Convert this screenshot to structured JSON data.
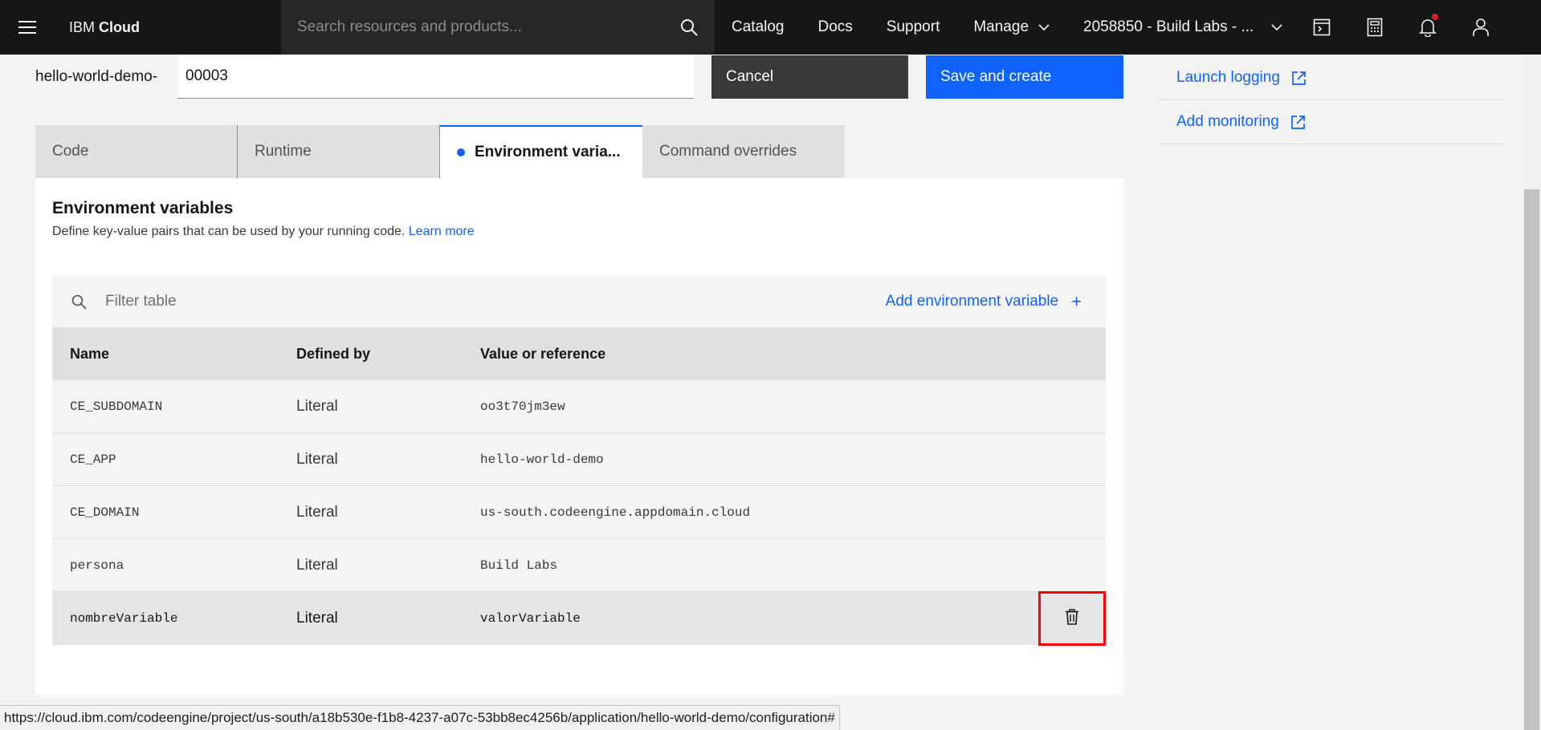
{
  "header": {
    "brand_light": "IBM ",
    "brand_bold": "Cloud",
    "search_placeholder": "Search resources and products...",
    "nav": [
      "Catalog",
      "Docs",
      "Support"
    ],
    "manage_label": "Manage",
    "account_label": "2058850 - Build Labs - ..."
  },
  "form": {
    "name_prefix": "hello-world-demo-",
    "name_value": "00003",
    "cancel_label": "Cancel",
    "save_label": "Save and create"
  },
  "side_links": {
    "logging": "Launch logging",
    "monitoring": "Add monitoring"
  },
  "tabs": {
    "code": "Code",
    "runtime": "Runtime",
    "env": "Environment varia...",
    "command": "Command overrides"
  },
  "panel": {
    "title": "Environment variables",
    "description": "Define key-value pairs that can be used by your running code. ",
    "learn_more": "Learn more"
  },
  "toolbar": {
    "filter_placeholder": "Filter table",
    "add_label": "Add environment variable",
    "add_plus": "+"
  },
  "table": {
    "headers": {
      "name": "Name",
      "defined_by": "Defined by",
      "value": "Value or reference"
    },
    "rows": [
      {
        "name": "CE_SUBDOMAIN",
        "defined_by": "Literal",
        "value": "oo3t70jm3ew"
      },
      {
        "name": "CE_APP",
        "defined_by": "Literal",
        "value": "hello-world-demo"
      },
      {
        "name": "CE_DOMAIN",
        "defined_by": "Literal",
        "value": "us-south.codeengine.appdomain.cloud"
      },
      {
        "name": "persona",
        "defined_by": "Literal",
        "value": "Build Labs"
      },
      {
        "name": "nombreVariable",
        "defined_by": "Literal",
        "value": "valorVariable"
      }
    ]
  },
  "status_url": "https://cloud.ibm.com/codeengine/project/us-south/a18b530e-f1b8-4237-a07c-53bb8ec4256b/application/hello-world-demo/configuration#",
  "colors": {
    "accent": "#0f62fe",
    "header_bg": "#161616",
    "highlight": "#ff0000",
    "notification": "#da1e28"
  }
}
